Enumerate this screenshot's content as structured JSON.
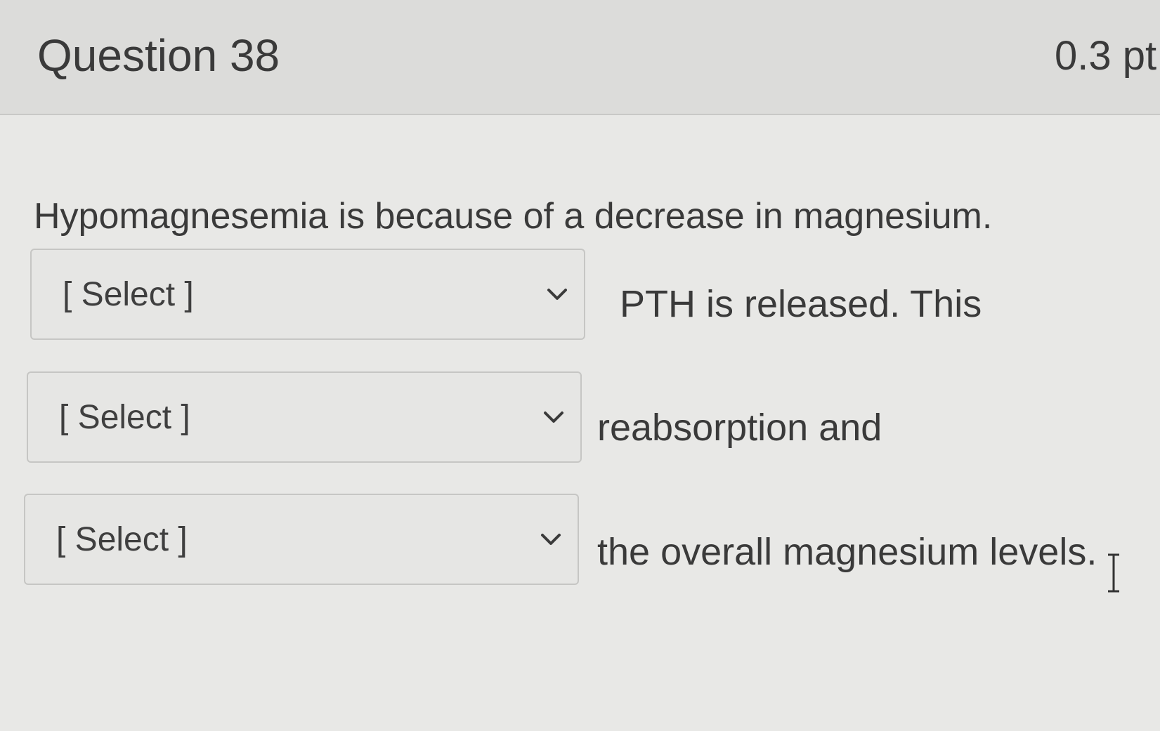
{
  "question": {
    "title": "Question 38",
    "points": "0.3 pt"
  },
  "prompt": "Hypomagnesemia is because of a decrease in magnesium.",
  "blanks": [
    {
      "placeholder": "[ Select ]",
      "after_text": "PTH is released.  This"
    },
    {
      "placeholder": "[ Select ]",
      "after_text": "reabsorption and"
    },
    {
      "placeholder": "[ Select ]",
      "after_text": "the overall magnesium levels."
    }
  ],
  "icons": {
    "dropdown": "chevron-down-icon",
    "cursor": "text-cursor-icon"
  },
  "colors": {
    "header_bg": "#dcdcda",
    "body_bg": "#e8e8e6",
    "text": "#3a3a3a",
    "border": "#c6c6c4"
  }
}
